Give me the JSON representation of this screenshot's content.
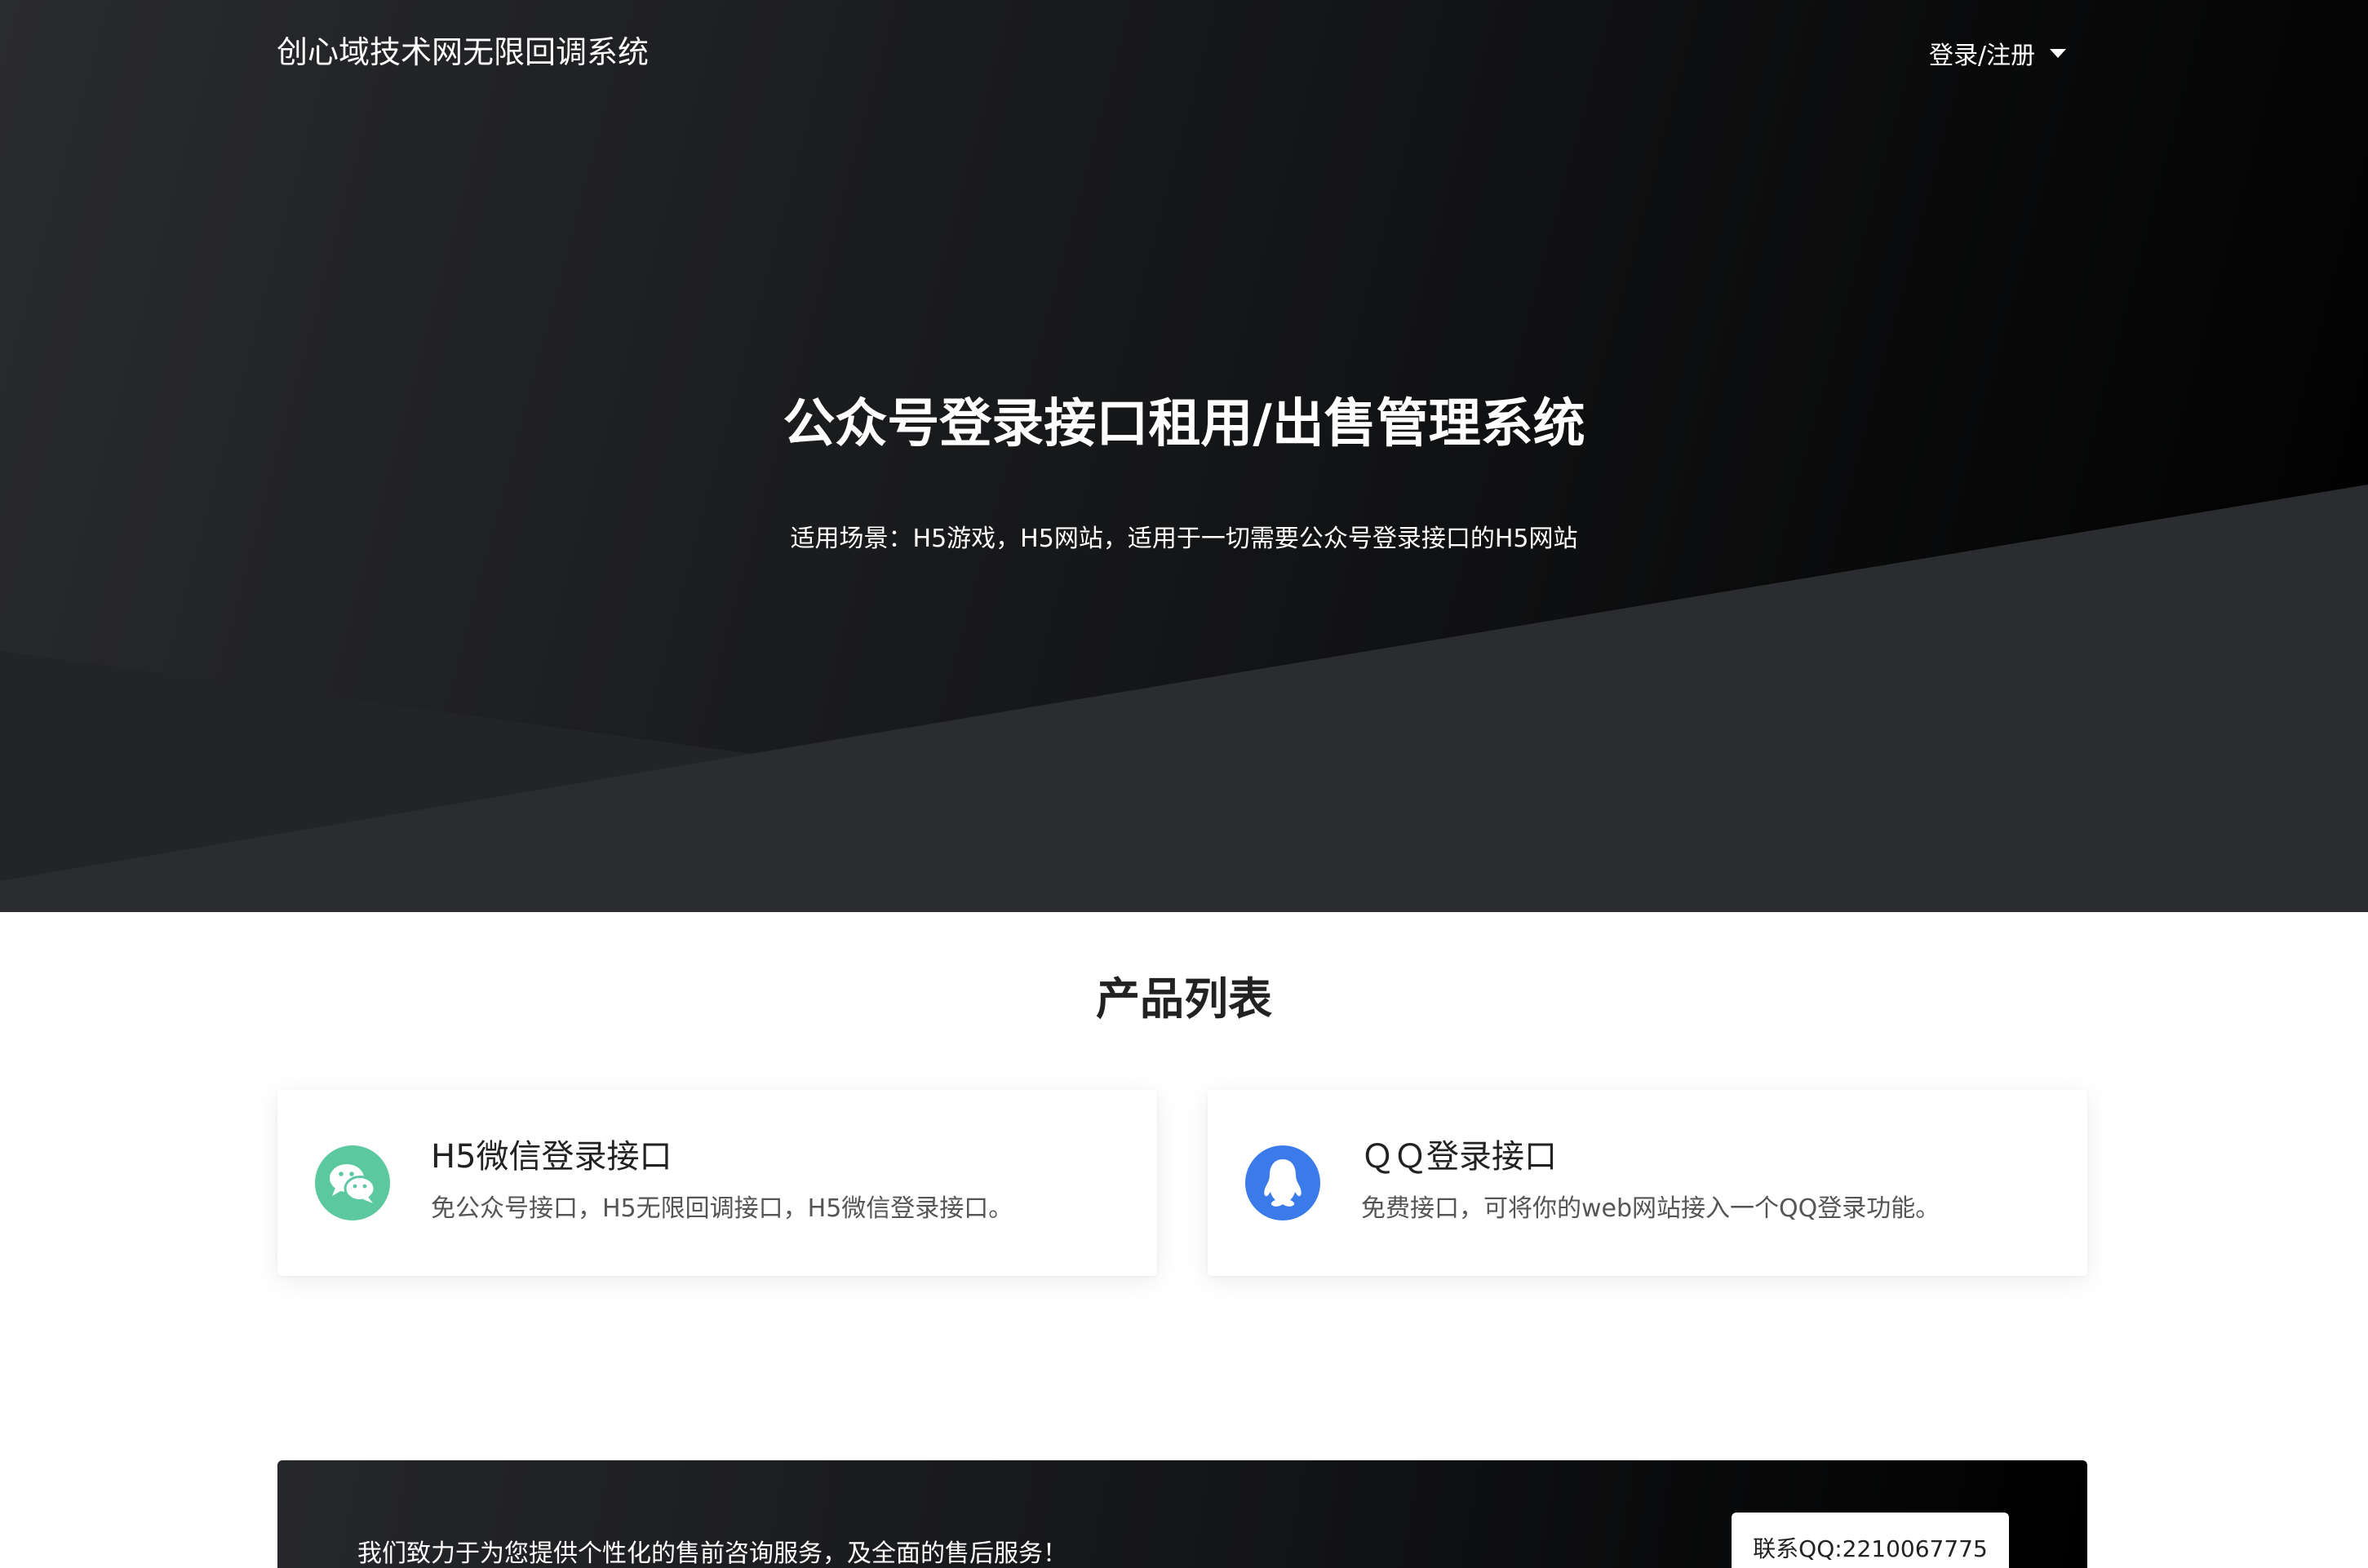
{
  "navbar": {
    "brand": "创心域技术网无限回调系统",
    "login_label": "登录/注册"
  },
  "hero": {
    "title_part1": "公众号登录",
    "title_bold1": "接口",
    "title_part2": "租",
    "title_bold2": "用",
    "title_part3": "/出售管理系统",
    "subtitle": "适用场景：H5游戏，H5网站，适用于一切需要公众号登录接口的H5网站"
  },
  "products": {
    "title": "产品列表",
    "items": [
      {
        "title": "H5微信登录接口",
        "desc": "免公众号接口，H5无限回调接口，H5微信登录接口。",
        "icon": "wechat-icon",
        "color": "#5cc8a0"
      },
      {
        "title": "ＱＱ登录接口",
        "desc": "免费接口，可将你的web网站接入一个QQ登录功能。",
        "icon": "qq-icon",
        "color": "#3b7be9"
      }
    ]
  },
  "cta": {
    "text": "我们致力于为您提供个性化的售前咨询服务，及全面的售后服务！",
    "button_label": "联系QQ:2210067775"
  }
}
